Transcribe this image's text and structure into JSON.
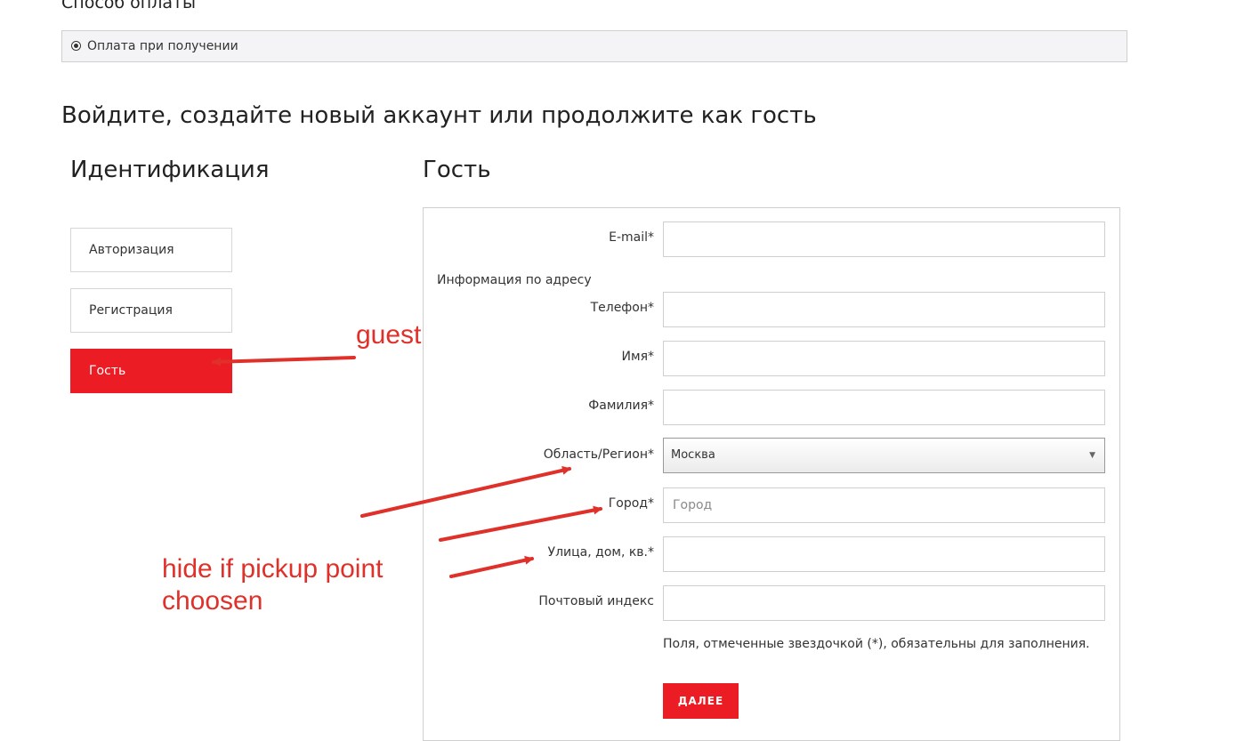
{
  "payment": {
    "title": "Способ оплаты",
    "option_label": "Оплата при получении"
  },
  "main_heading": "Войдите, создайте новый аккаунт или продолжите как гость",
  "identification": {
    "heading": "Идентификация",
    "tabs": [
      {
        "label": "Авторизация",
        "active": false
      },
      {
        "label": "Регистрация",
        "active": false
      },
      {
        "label": "Гость",
        "active": true
      }
    ]
  },
  "guest": {
    "heading": "Гость",
    "email_label": "E-mail*",
    "address_section_label": "Информация по адресу",
    "phone_label": "Телефон*",
    "first_name_label": "Имя*",
    "last_name_label": "Фамилия*",
    "region_label": "Область/Регион*",
    "region_value": "Москва",
    "city_label": "Город*",
    "city_placeholder": "Город",
    "street_label": "Улица, дом, кв.*",
    "postal_label": "Почтовый индекс",
    "required_note": "Поля, отмеченные звездочкой (*), обязательны для заполнения.",
    "next_button": "ДАЛЕЕ"
  },
  "annotations": {
    "guest": "guest",
    "hide_line1": "hide if pickup point",
    "hide_line2": "choosen",
    "color": "#e0302a"
  },
  "colors": {
    "accent": "#ec1c24"
  }
}
